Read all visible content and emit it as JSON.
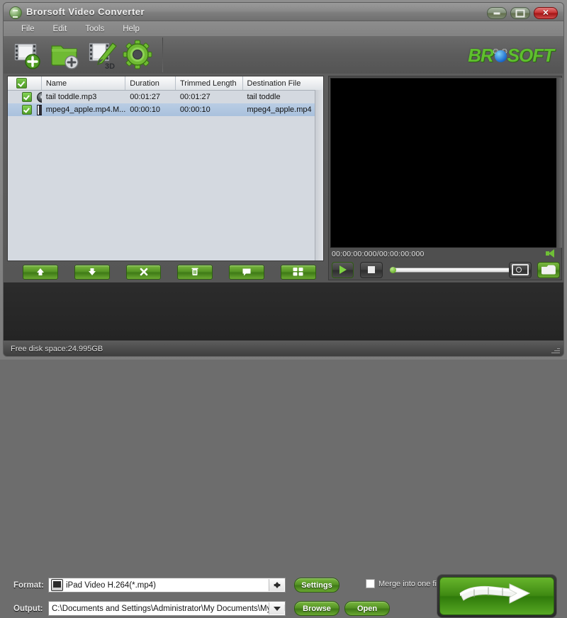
{
  "window": {
    "title": "Brorsoft Video Converter",
    "app_icon": "film-reel-icon",
    "minimize_label": "",
    "maximize_label": "",
    "close_label": "✕"
  },
  "menubar": {
    "items": [
      {
        "label": "File"
      },
      {
        "label": "Edit"
      },
      {
        "label": "Tools"
      },
      {
        "label": "Help"
      }
    ]
  },
  "toolbar": {
    "buttons": [
      {
        "name": "add-video-button",
        "icon": "film-plus-icon"
      },
      {
        "name": "add-folder-button",
        "icon": "folder-plus-icon"
      },
      {
        "name": "edit-3d-button",
        "icon": "film-pencil-3d-icon"
      },
      {
        "name": "settings-gear-button",
        "icon": "gear-icon"
      }
    ],
    "logo_left": "BR",
    "logo_right": "SOFT"
  },
  "filelist": {
    "columns": [
      "",
      "Name",
      "Duration",
      "Trimmed Length",
      "Destination File"
    ],
    "header_checkbox_checked": true,
    "rows": [
      {
        "checked": true,
        "icon": "audio-disc-icon",
        "name": "tail toddle.mp3",
        "duration": "00:01:27",
        "trimmed": "00:01:27",
        "destination": "tail toddle",
        "selected": false
      },
      {
        "checked": true,
        "icon": "video-film-icon",
        "name": "mpeg4_apple.mp4.M...",
        "duration": "00:00:10",
        "trimmed": "00:00:10",
        "destination": "mpeg4_apple.mp4",
        "selected": true
      }
    ],
    "actions": [
      {
        "name": "move-up-button",
        "glyph": "↑"
      },
      {
        "name": "move-down-button",
        "glyph": "↓"
      },
      {
        "name": "remove-button",
        "glyph": "✖"
      },
      {
        "name": "clear-all-button",
        "glyph": "Ὕ1"
      },
      {
        "name": "subtitle-button",
        "glyph": "⌨"
      },
      {
        "name": "merge-button",
        "glyph": "☷"
      }
    ]
  },
  "preview": {
    "timecode": "00:00:00:000/00:00:00:000",
    "play_label": "",
    "stop_label": "",
    "seek_position_percent": 0,
    "volume_icon": "speaker-icon",
    "snapshot_icon": "camera-icon",
    "open_folder_icon": "folder-open-icon"
  },
  "settings": {
    "format_label": "Format:",
    "format_value": "iPad Video H.264(*.mp4)",
    "format_icon": "ipad-device-icon",
    "output_label": "Output:",
    "output_value": "C:\\Documents and Settings\\Administrator\\My Documents\\My Videos",
    "settings_button": "Settings",
    "browse_button": "Browse",
    "open_button": "Open",
    "merge_label": "Merge into one file",
    "merge_checked": false,
    "convert_button_name": "convert-button"
  },
  "statusbar": {
    "text": "Free disk space:24.995GB"
  },
  "colors": {
    "accent_green": "#5fbf2e",
    "button_green": "#4f9a22",
    "close_red": "#c63030",
    "list_bg": "#d4d9e0",
    "selection_blue": "#b0c6e0"
  }
}
